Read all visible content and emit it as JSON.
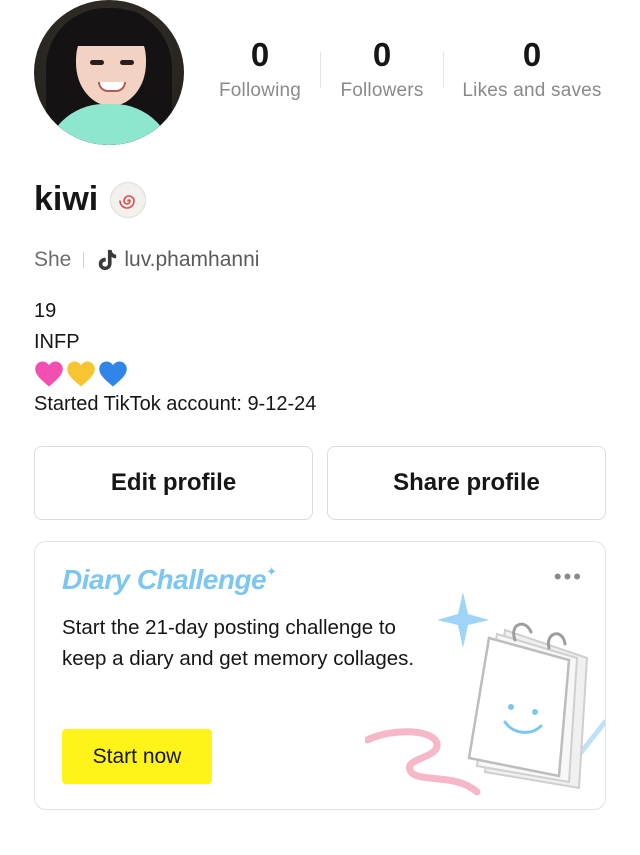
{
  "profile": {
    "name": "kiwi",
    "pronoun": "She",
    "handle": "luv.phamhanni",
    "bio": {
      "line1": "19",
      "line2": "INFP",
      "hearts": [
        "pink-heart",
        "yellow-heart",
        "blue-heart"
      ],
      "line4": "Started TikTok account: 9-12-24"
    }
  },
  "stats": [
    {
      "value": "0",
      "label": "Following"
    },
    {
      "value": "0",
      "label": "Followers"
    },
    {
      "value": "0",
      "label": "Likes and saves"
    }
  ],
  "actions": {
    "edit_label": "Edit profile",
    "share_label": "Share profile"
  },
  "card": {
    "title": "Diary Challenge",
    "description": "Start the 21-day posting challenge to keep a diary and get memory collages.",
    "button_label": "Start now",
    "menu_icon": "more-dots-icon"
  },
  "colors": {
    "accent_yellow": "#fff31a",
    "title_blue": "#7cc6ef",
    "muted_text": "#8a8a8a",
    "heart_pink": "#f24fb1",
    "heart_yellow": "#f7c531",
    "heart_blue": "#2f86e8"
  }
}
